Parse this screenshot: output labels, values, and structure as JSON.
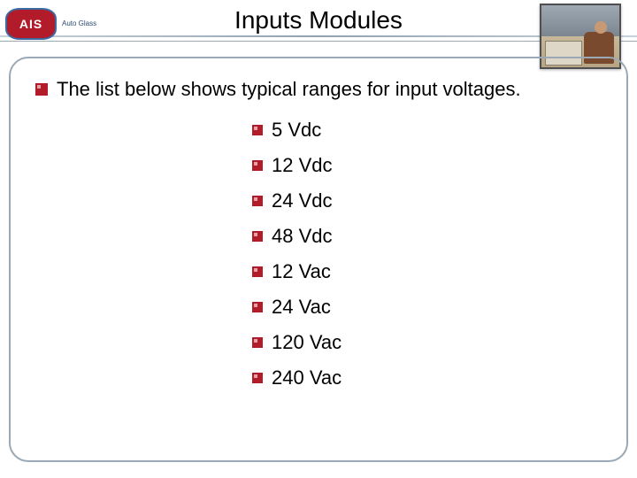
{
  "logo": {
    "abbr": "AIS",
    "sub": "Auto Glass"
  },
  "title": "Inputs Modules",
  "intro": "The list below shows typical ranges for input voltages.",
  "voltages": [
    "5 Vdc",
    "12 Vdc",
    "24 Vdc",
    "48 Vdc",
    "12 Vac",
    "24 Vac",
    "120 Vac",
    "240 Vac"
  ]
}
